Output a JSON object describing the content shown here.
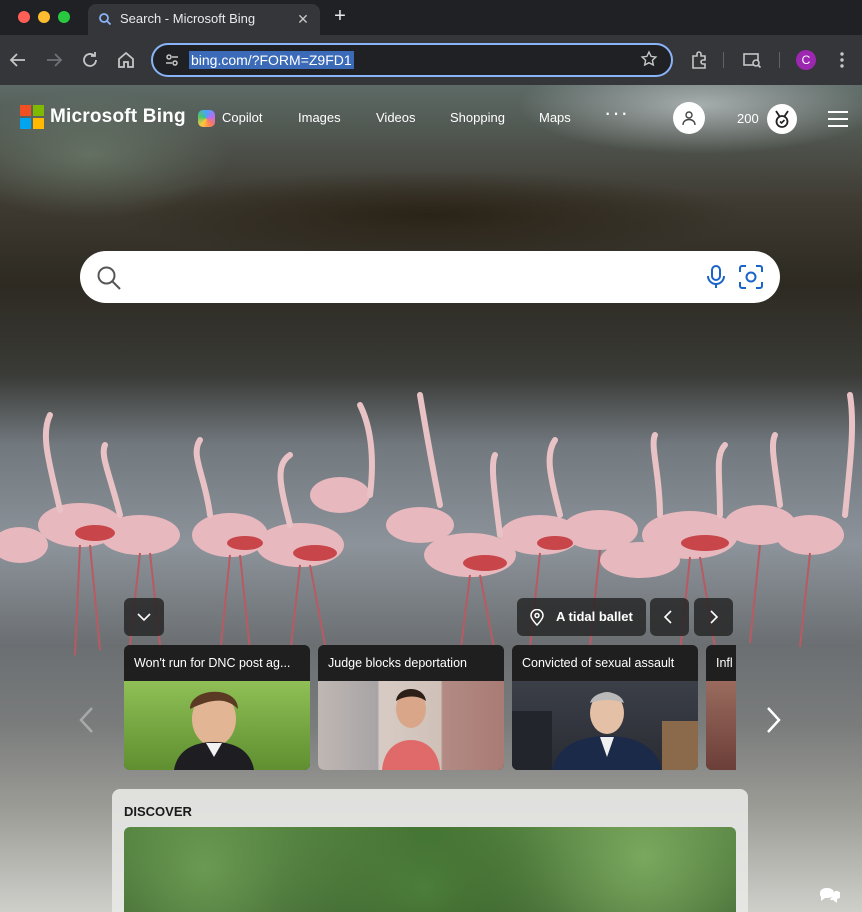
{
  "browser": {
    "tab_title": "Search - Microsoft Bing",
    "tab_close_glyph": "✕",
    "new_tab_glyph": "+",
    "url": "bing.com/?FORM=Z9FD1",
    "profile_initial": "C",
    "profile_color": "#9c27b0",
    "icons": [
      "back-icon",
      "forward-icon",
      "reload-icon",
      "home-icon",
      "site-info-icon",
      "star-icon",
      "extensions-icon",
      "tab-search-icon",
      "menu-dots-icon"
    ]
  },
  "header": {
    "brand": "Microsoft Bing",
    "nav": [
      "Copilot",
      "Images",
      "Videos",
      "Shopping",
      "Maps"
    ],
    "more": "···",
    "points": "200"
  },
  "search": {
    "placeholder": "",
    "icons": [
      "search-icon",
      "microphone-icon",
      "visual-search-icon"
    ]
  },
  "image_info": {
    "title": "A tidal ballet"
  },
  "news_cards": [
    {
      "headline": "Won't run for DNC post ag..."
    },
    {
      "headline": "Judge blocks deportation"
    },
    {
      "headline": "Convicted of sexual assault"
    },
    {
      "headline": "Infl"
    }
  ],
  "discover": {
    "title": "DISCOVER"
  },
  "colors": {
    "accent": "#8ab4f8",
    "logo_red": "#f25022",
    "logo_green": "#7fba00",
    "logo_blue": "#00a4ef",
    "logo_yellow": "#ffb900"
  }
}
